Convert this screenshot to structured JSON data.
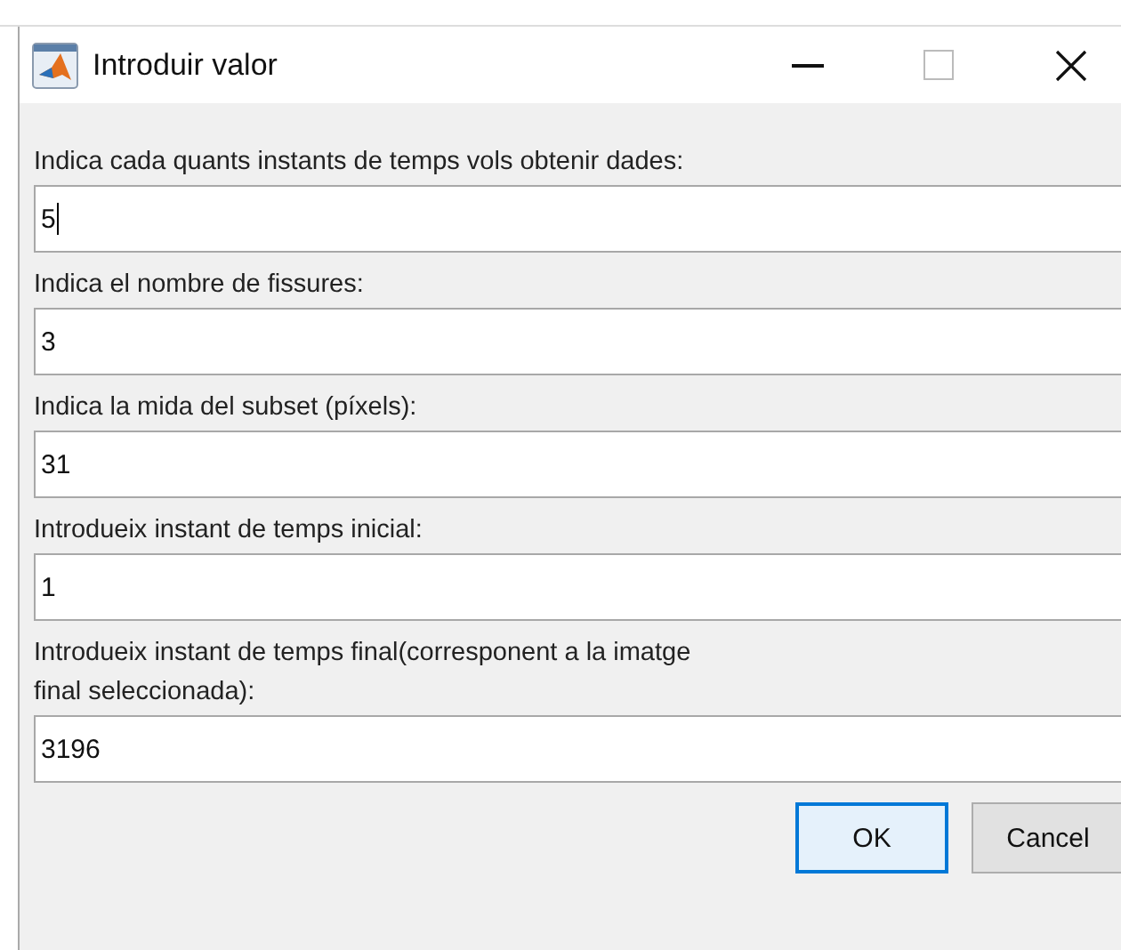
{
  "window": {
    "title": "Introduir valor"
  },
  "fields": [
    {
      "label": "Indica cada quants instants de temps vols obtenir dades:",
      "value": "5",
      "focused": true
    },
    {
      "label": "Indica el nombre de fissures:",
      "value": "3",
      "focused": false
    },
    {
      "label": "Indica la mida del subset (píxels):",
      "value": "31",
      "focused": false
    },
    {
      "label": "Introdueix instant de temps inicial:",
      "value": "1",
      "focused": false
    },
    {
      "label": "Introdueix instant de temps final(corresponent a la imatge\nfinal seleccionada):",
      "value": "3196",
      "focused": false
    }
  ],
  "buttons": [
    {
      "label": "OK",
      "default": true
    },
    {
      "label": "Cancel",
      "default": false
    }
  ]
}
